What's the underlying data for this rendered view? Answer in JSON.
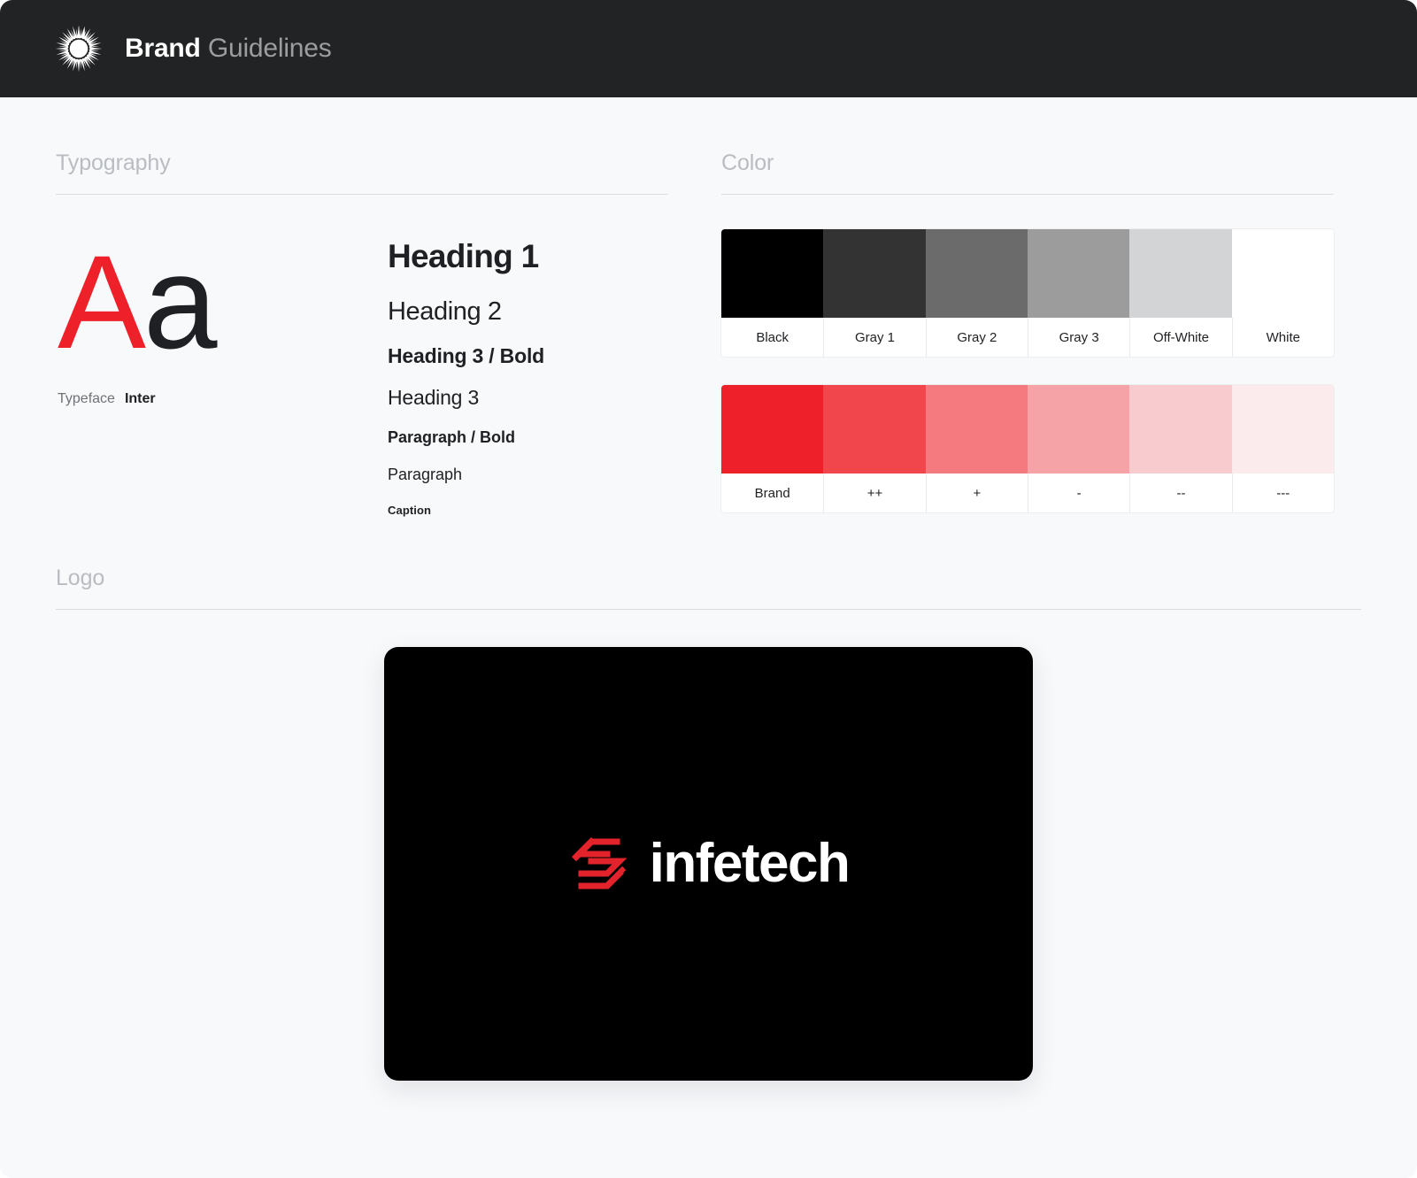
{
  "header": {
    "logo_icon": "starburst-icon",
    "title_strong": "Brand",
    "title_muted": "Guidelines"
  },
  "typography": {
    "section_title": "Typography",
    "specimen_upper": "A",
    "specimen_lower": "a",
    "specimen_upper_color": "#EE2029",
    "specimen_lower_color": "#1F2023",
    "typeface_label": "Typeface",
    "typeface_value": "Inter",
    "scale": [
      {
        "label": "Heading 1",
        "style": "h1"
      },
      {
        "label": "Heading 2",
        "style": "h2"
      },
      {
        "label": "Heading 3 / Bold",
        "style": "h3-bold"
      },
      {
        "label": "Heading 3",
        "style": "h3"
      },
      {
        "label": "Paragraph / Bold",
        "style": "p-bold"
      },
      {
        "label": "Paragraph",
        "style": "p"
      },
      {
        "label": "Caption",
        "style": "caption"
      }
    ]
  },
  "color": {
    "section_title": "Color",
    "neutral_row": [
      {
        "name": "Black",
        "hex": "#000000"
      },
      {
        "name": "Gray 1",
        "hex": "#333333"
      },
      {
        "name": "Gray 2",
        "hex": "#6B6B6B"
      },
      {
        "name": "Gray 3",
        "hex": "#9C9C9C"
      },
      {
        "name": "Off-White",
        "hex": "#D3D4D5"
      },
      {
        "name": "White",
        "hex": "#FFFFFF"
      }
    ],
    "brand_row": [
      {
        "name": "Brand",
        "hex": "#EE2029"
      },
      {
        "name": "++",
        "hex": "#F2464D"
      },
      {
        "name": "+",
        "hex": "#F47A80"
      },
      {
        "name": "-",
        "hex": "#F6A3A7"
      },
      {
        "name": "--",
        "hex": "#F8CCCF"
      },
      {
        "name": "---",
        "hex": "#FCEBEC"
      }
    ]
  },
  "logo": {
    "section_title": "Logo",
    "card_background": "#000000",
    "mark_color": "#E3232B",
    "wordmark": "infetech",
    "wordmark_color": "#FFFFFF"
  }
}
